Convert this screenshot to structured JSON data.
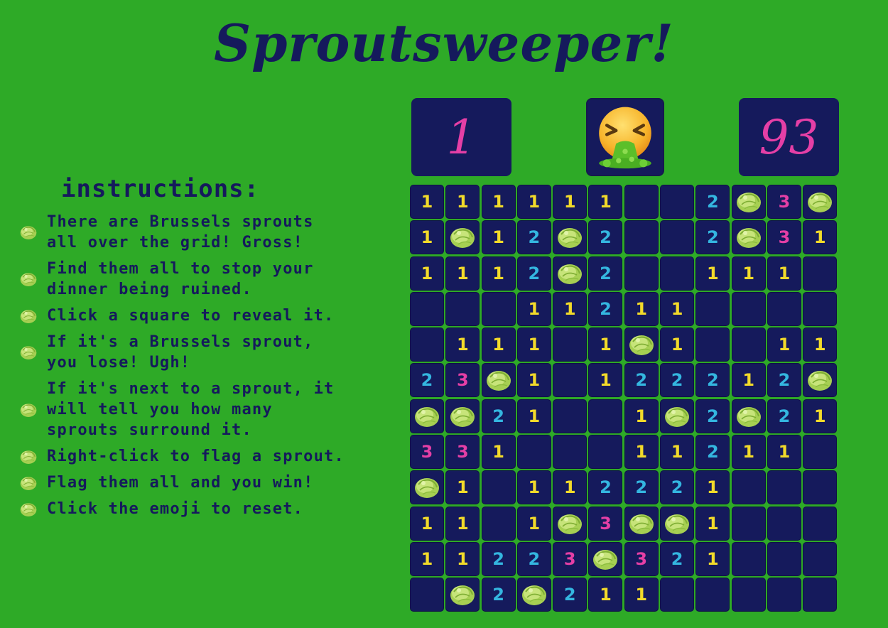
{
  "title": "Sproutsweeper!",
  "counters": {
    "left": "1",
    "right": "93"
  },
  "reset_emoji": "face-vomiting-icon",
  "instructions": {
    "heading": "instructions:",
    "items": [
      "There are Brussels sprouts\nall over the grid! Gross!",
      "Find them all to stop your\ndinner being ruined.",
      "Click a square to reveal it.",
      "If it's a Brussels sprout,\nyou lose! Ugh!",
      "If it's next to a sprout, it\nwill tell you how many\nsprouts surround it.",
      "Right-click to flag a sprout.",
      "Flag them all and you win!",
      "Click the emoji to reset."
    ]
  },
  "colors": {
    "background": "#2eaa27",
    "panel": "#151a5c",
    "counter": "#e53fa6",
    "num1": "#f2da2a",
    "num2": "#34b6e0",
    "num3": "#e53fa6"
  },
  "board": [
    [
      "1",
      "1",
      "1",
      "1",
      "1",
      "1",
      "",
      "",
      "2",
      "S",
      "3",
      "S"
    ],
    [
      "1",
      "S",
      "1",
      "2",
      "S",
      "2",
      "",
      "",
      "2",
      "S",
      "3",
      "1"
    ],
    [
      "1",
      "1",
      "1",
      "2",
      "S",
      "2",
      "",
      "",
      "1",
      "1",
      "1",
      ""
    ],
    [
      "",
      "",
      "",
      "1",
      "1",
      "2",
      "1",
      "1",
      "",
      "",
      "",
      ""
    ],
    [
      "",
      "1",
      "1",
      "1",
      "",
      "1",
      "S",
      "1",
      "",
      "",
      "1",
      "1"
    ],
    [
      "2",
      "3",
      "S",
      "1",
      "",
      "1",
      "2",
      "2",
      "2",
      "1",
      "2",
      "S"
    ],
    [
      "S",
      "S",
      "2",
      "1",
      "",
      "",
      "1",
      "S",
      "2",
      "S",
      "2",
      "1"
    ],
    [
      "3",
      "3",
      "1",
      "",
      "",
      "",
      "1",
      "1",
      "2",
      "1",
      "1",
      ""
    ],
    [
      "S",
      "1",
      "",
      "1",
      "1",
      "2",
      "2",
      "2",
      "1",
      "",
      "",
      ""
    ],
    [
      "1",
      "1",
      "",
      "1",
      "S",
      "3",
      "S",
      "S",
      "1",
      "",
      "",
      ""
    ],
    [
      "1",
      "1",
      "2",
      "2",
      "3",
      "S",
      "3",
      "2",
      "1",
      "",
      "",
      ""
    ],
    [
      "",
      "S",
      "2",
      "S",
      "2",
      "1",
      "1",
      "",
      "",
      "",
      "",
      ""
    ]
  ]
}
